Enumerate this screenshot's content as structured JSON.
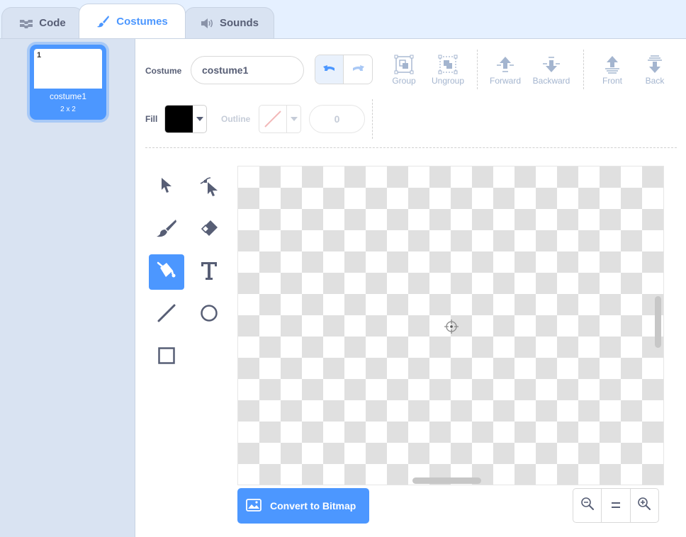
{
  "tabs": {
    "code": "Code",
    "costumes": "Costumes",
    "sounds": "Sounds"
  },
  "sidebar": {
    "costume": {
      "number": "1",
      "name": "costume1",
      "size": "2 x 2"
    }
  },
  "toolbar": {
    "costume_label": "Costume",
    "costume_name": "costume1",
    "group": "Group",
    "ungroup": "Ungroup",
    "forward": "Forward",
    "backward": "Backward",
    "front": "Front",
    "back": "Back",
    "fill_label": "Fill",
    "outline_label": "Outline",
    "outline_width": "0"
  },
  "tools": [
    "select",
    "reshape",
    "brush",
    "eraser",
    "fill",
    "text",
    "line",
    "circle",
    "rectangle"
  ],
  "active_tool": "fill",
  "convert_button": "Convert to Bitmap",
  "zoom": {
    "out": "zoom-out",
    "reset": "=",
    "in": "zoom-in"
  },
  "colors": {
    "accent": "#4c97ff",
    "fill": "#000000",
    "sidebar": "#d9e3f2",
    "tool_icon": "#575e75",
    "disabled": "#a4b5cf"
  }
}
